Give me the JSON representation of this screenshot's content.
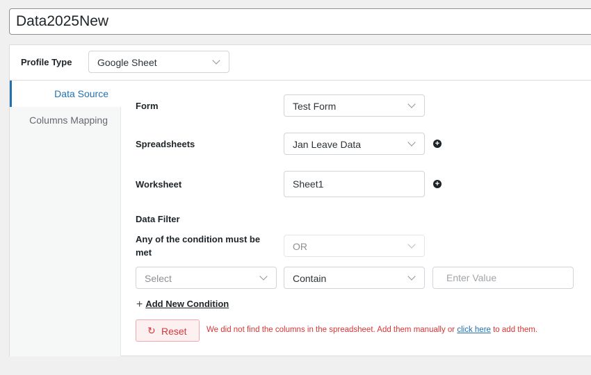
{
  "profile_name": "Data2025New",
  "profile_type": {
    "label": "Profile Type",
    "selected": "Google Sheet"
  },
  "sidebar": {
    "items": [
      {
        "label": "Data Source"
      },
      {
        "label": "Columns Mapping"
      }
    ]
  },
  "form_field": {
    "label": "Form",
    "selected": "Test Form"
  },
  "spreadsheets_field": {
    "label": "Spreadsheets",
    "selected": "Jan Leave Data",
    "add_icon": "+"
  },
  "worksheet_field": {
    "label": "Worksheet",
    "value": "Sheet1",
    "add_icon": "+"
  },
  "data_filter": {
    "heading": "Data Filter",
    "condition_label": "Any of the condition must be met",
    "condition_selected": "OR",
    "condition_row": {
      "column_placeholder": "Select",
      "operator_selected": "Contain",
      "value_placeholder": "Enter Value"
    },
    "add_condition_icon": "+",
    "add_condition_label": "Add New Condition"
  },
  "reset": {
    "icon": "↻",
    "label": "Reset"
  },
  "notice": {
    "text_before": "We did not find the columns in the spreadsheet. Add them manually or ",
    "link_text": "click here",
    "text_after": " to add them."
  },
  "colors": {
    "accent": "#2271b1",
    "error": "#d63638",
    "text": "#1d2327"
  }
}
